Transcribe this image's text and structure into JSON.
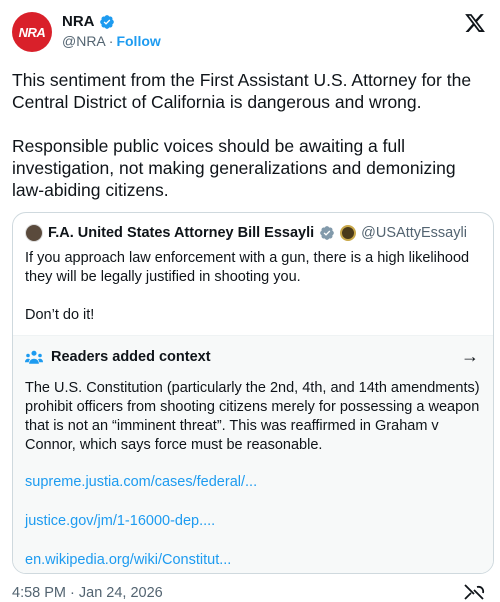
{
  "author": {
    "avatar_text": "NRA",
    "name": "NRA",
    "handle": "@NRA",
    "separator": "·",
    "follow_label": "Follow"
  },
  "tweet": {
    "paragraphs": [
      "This sentiment from the First Assistant U.S. Attorney for the Central District of California is dangerous and wrong.",
      "Responsible public voices should be awaiting a full investigation, not making generalizations and demonizing law-abiding citizens."
    ]
  },
  "quote": {
    "name": "F.A. United States Attorney Bill Essayli",
    "handle": "@USAttyEssayli",
    "paragraphs": [
      "If you approach law enforcement with a gun, there is a high likelihood they will be legally justified in shooting you.",
      "Don’t do it!"
    ]
  },
  "context": {
    "title": "Readers added context",
    "arrow": "→",
    "text": "The U.S. Constitution (particularly the 2nd, 4th, and 14th amendments) prohibit officers from shooting citizens merely for possessing a weapon that is not an “imminent threat”. This was reaffirmed in Graham v Connor, which says force must be reasonable.",
    "links": [
      "supreme.justia.com/cases/federal/...",
      "justice.gov/jm/1-16000-dep....",
      "en.wikipedia.org/wiki/Constitut..."
    ]
  },
  "footer": {
    "timestamp": "4:58 PM · Jan 24, 2026"
  },
  "colors": {
    "brand_red": "#d9202a",
    "link_blue": "#1d9bf0",
    "muted": "#536471"
  },
  "icons": [
    "verified-badge-icon",
    "x-logo-icon",
    "readers-context-icon",
    "arrow-right-icon",
    "grok-icon"
  ]
}
